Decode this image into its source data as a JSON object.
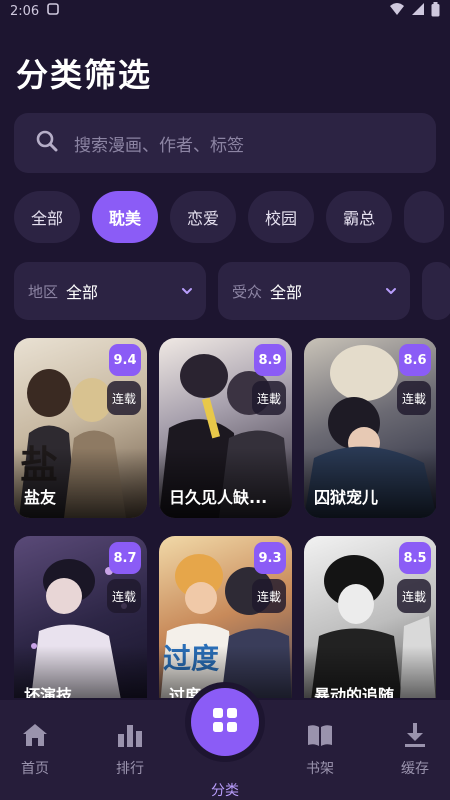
{
  "status_bar": {
    "time": "2:06"
  },
  "page": {
    "title": "分类筛选"
  },
  "search": {
    "placeholder": "搜索漫画、作者、标签"
  },
  "chips": [
    "全部",
    "耽美",
    "恋爱",
    "校园",
    "霸总"
  ],
  "active_chip": "耽美",
  "filters": [
    {
      "label": "地区",
      "value": "全部"
    },
    {
      "label": "受众",
      "value": "全部"
    }
  ],
  "comics": [
    {
      "title": "盐友",
      "score": "9.4",
      "status": "连载"
    },
    {
      "title": "日久见人缺...",
      "score": "8.9",
      "status": "连載"
    },
    {
      "title": "囚狱宠儿",
      "score": "8.6",
      "status": "连載"
    },
    {
      "title": "坏演技",
      "score": "8.7",
      "status": "连载"
    },
    {
      "title": "过度自由",
      "score": "9.3",
      "status": "连載"
    },
    {
      "title": "暴动的追随",
      "score": "8.5",
      "status": "连載"
    }
  ],
  "nav": {
    "home": "首页",
    "rank": "排行",
    "category": "分类",
    "shelf": "书架",
    "download": "缓存"
  },
  "colors": {
    "background": "#1d1530",
    "surface": "#2c2343",
    "accent": "#8b5cf6",
    "nav_bg": "#261d3a"
  }
}
